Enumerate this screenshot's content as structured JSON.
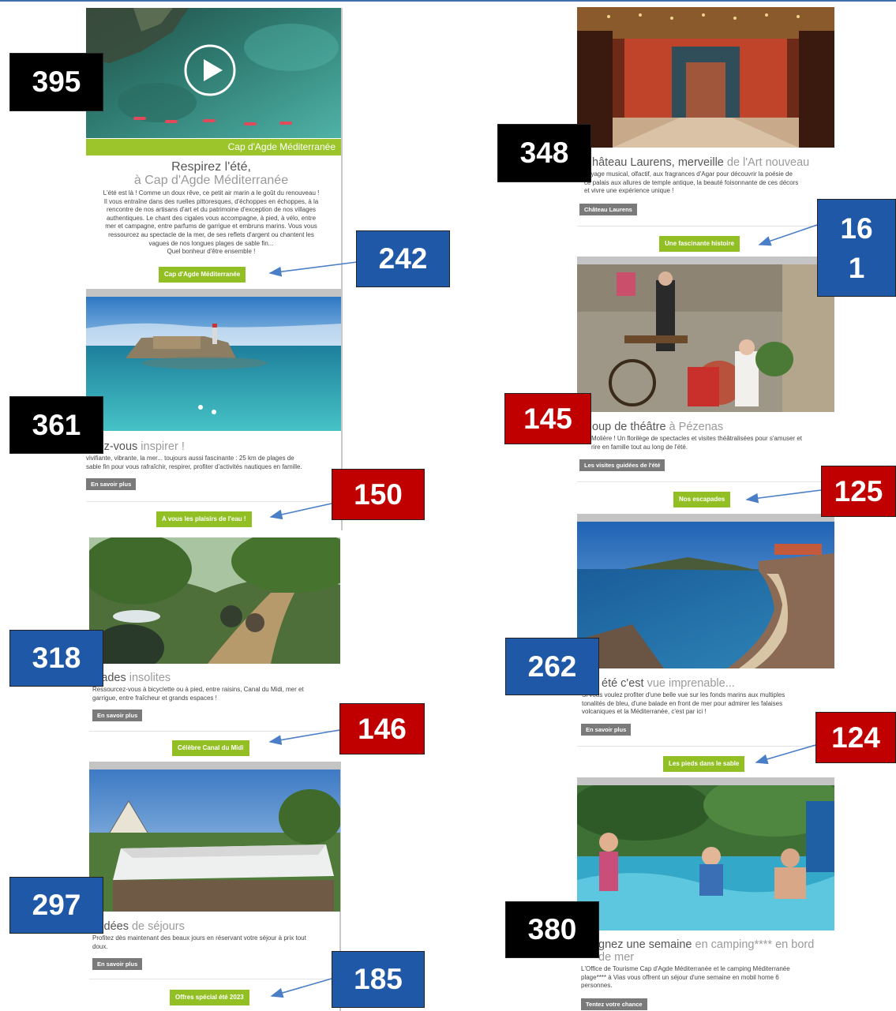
{
  "colors": {
    "accent_green": "#92c024",
    "badge_black": "#000000",
    "badge_blue": "#1f58a7",
    "badge_red": "#c00000",
    "arrow": "#4a7ec6"
  },
  "left_column": {
    "hero": {
      "caption": "Cap d'Agde Méditerranée",
      "title_line1": "Respirez l'été,",
      "title_line2_light": "à Cap d'Agde Méditerranée",
      "description_lines": [
        "L'été est là ! Comme un doux rêve, ce petit air marin a le goût du renouveau !",
        "Il vous entraîne dans des ruelles pittoresques, d'échoppes en échoppes, à la",
        "rencontre de nos artisans d'art et du patrimoine d'exception de nos villages",
        "authentiques. Le chant des cigales vous accompagne, à pied, à vélo, entre",
        "mer et campagne, entre parfums de garrigue et embruns marins. Vous vous",
        "ressourcez au spectacle de la mer, de ses reflets d'argent ou chantent les",
        "vagues de nos longues plages de sable fin...",
        "Quel bonheur d'être ensemble !"
      ],
      "button": "Cap d'Agde Méditerranée"
    },
    "water": {
      "title_dark": "ssez-vous",
      "title_light": " inspirer !",
      "description_lines": [
        "vivifiante, vibrante, la mer... toujours aussi fascinante : 25 km de plages de",
        "sable fin pour vous rafraîchir, respirer, profiter d'activités nautiques en famille."
      ],
      "more_button": "En savoir plus",
      "button": "A vous les plaisirs de l'eau !"
    },
    "walks": {
      "title_dark": "alades",
      "title_light": " insolites",
      "description_lines": [
        "Ressourcez-vous à bicyclette ou à pied, entre raisins, Canal du Midi, mer et",
        "garrigue, entre fraîcheur et grands espaces !"
      ],
      "more_button": "En savoir plus",
      "button": "Célèbre Canal du Midi"
    },
    "stays": {
      "title_dark": "s idées",
      "title_light": " de séjours",
      "description_lines": [
        "Profitez dès maintenant des beaux jours en réservant votre séjour à prix tout",
        "doux."
      ],
      "more_button": "En savoir plus",
      "button": "Offres spécial été 2023"
    }
  },
  "right_column": {
    "castle": {
      "title_dark": "hâteau Laurens, merveille",
      "title_light": " de l'Art nouveau",
      "description_lines": [
        "voyage musical, olfactif, aux fragrances d'Agar pour découvrir la poésie de",
        "ce palais aux allures de temple antique, la beauté foisonnante de ces décors",
        "et vivre une expérience unique !"
      ],
      "more_button": "Château Laurens",
      "button": "Une fascinante histoire"
    },
    "theatre": {
      "title_dark": "oup de théâtre",
      "title_light": " à Pézenas",
      "description_lines": [
        "Molière ! Un florilège de spectacles et visites théâtralisées pour s'amuser et",
        "rire en famille tout au long de l'été."
      ],
      "more_button": "Les visites guidées de l'été",
      "button": "Nos escapades"
    },
    "beach": {
      "title_dark": "été c'est",
      "title_light": " vue imprenable...",
      "description_lines": [
        "Si vous voulez profiter d'une belle vue sur les fonds marins aux multiples",
        "tonalités de bleu, d'une balade en front de mer pour admirer les falaises",
        "volcaniques et la Méditerranée, c'est par ici !"
      ],
      "more_button": "En savoir plus",
      "button": "Les pieds dans le sable"
    },
    "contest": {
      "title_dark": "gnez une semaine",
      "title_light": " en camping**** en bord",
      "title_line2_light": "de mer",
      "description_lines": [
        "L'Office de Tourisme Cap d'Agde Méditerranée et le camping Méditerranée",
        "plage**** à Vias vous offrent un séjour d'une semaine en mobil home 6",
        "personnes."
      ],
      "more_button": "Tentez votre chance"
    }
  },
  "badges": {
    "hero": "395",
    "hero_button": "242",
    "water": "361",
    "water_button": "150",
    "walks": "318",
    "walks_button": "146",
    "stays": "297",
    "stays_button": "185",
    "castle": "348",
    "castle_button_line1": "16",
    "castle_button_line2": "1",
    "theatre": "145",
    "theatre_button": "125",
    "beach": "262",
    "beach_button": "124",
    "contest": "380"
  }
}
